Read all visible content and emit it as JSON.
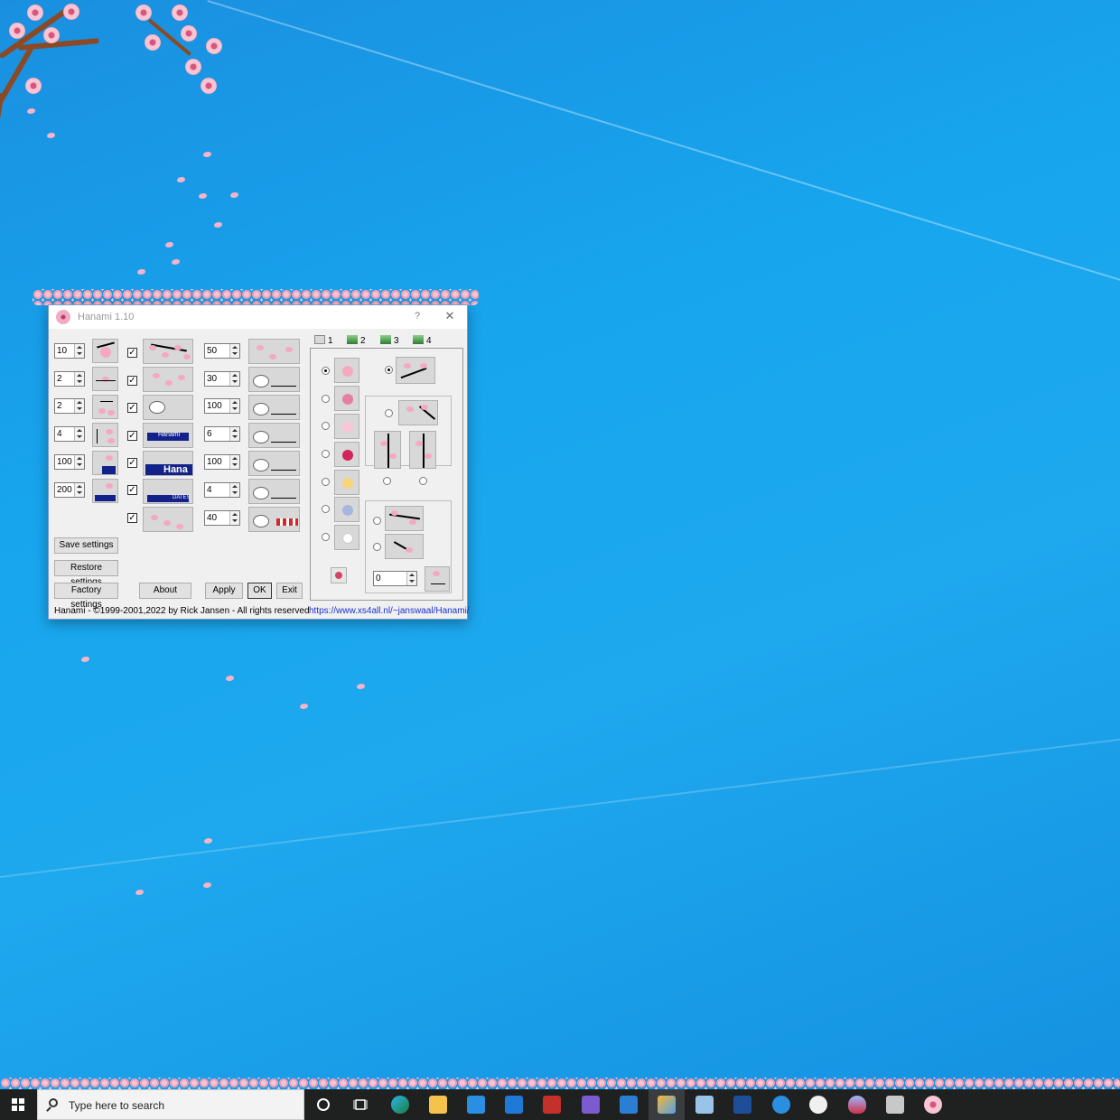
{
  "window": {
    "title": "Hanami 1.10",
    "help_label": "?",
    "close_label": "✕"
  },
  "left_spinners": [
    "10",
    "2",
    "2",
    "4",
    "100",
    "200"
  ],
  "mid_spinners": [
    "50",
    "30",
    "100",
    "6",
    "100",
    "4",
    "40"
  ],
  "checkboxes_checked": [
    true,
    true,
    true,
    true,
    true,
    true,
    true
  ],
  "thumb_texts": {
    "hanami_small": "Hanami",
    "hanami_big": "Hana",
    "dates": "DATES"
  },
  "buttons": {
    "save": "Save settings",
    "restore": "Restore settings",
    "factory": "Factory settings",
    "about": "About",
    "apply": "Apply",
    "ok": "OK",
    "exit": "Exit"
  },
  "tabs": [
    {
      "label": "1",
      "selected": true
    },
    {
      "label": "2",
      "selected": false
    },
    {
      "label": "3",
      "selected": false
    },
    {
      "label": "4",
      "selected": false
    }
  ],
  "tab_panel": {
    "flower_radio_selected_index": 0,
    "branch_spinner": "0"
  },
  "status_text": "Hanami -  ©1999-2001,2022 by Rick Jansen - All rights reserved",
  "link_text": "https://www.xs4all.nl/~janswaal/Hanami/",
  "taskbar": {
    "search_placeholder": "Type here to search",
    "icons": [
      "cortana-icon",
      "task-view-icon",
      "edge-icon",
      "file-explorer-icon",
      "store-icon",
      "mail-icon",
      "office-icon",
      "visual-studio-icon",
      "vscode-icon",
      "paint-icon",
      "notepad-icon",
      "powershell-icon",
      "settings-gear-icon",
      "itunes-icon",
      "flame-icon",
      "remote-desktop-icon",
      "hanami-icon"
    ]
  },
  "colors": {
    "desktop": "#1ea8ee",
    "taskbar": "#1f2020",
    "petal": "#f6b4c8",
    "link": "#1a2fd0"
  }
}
